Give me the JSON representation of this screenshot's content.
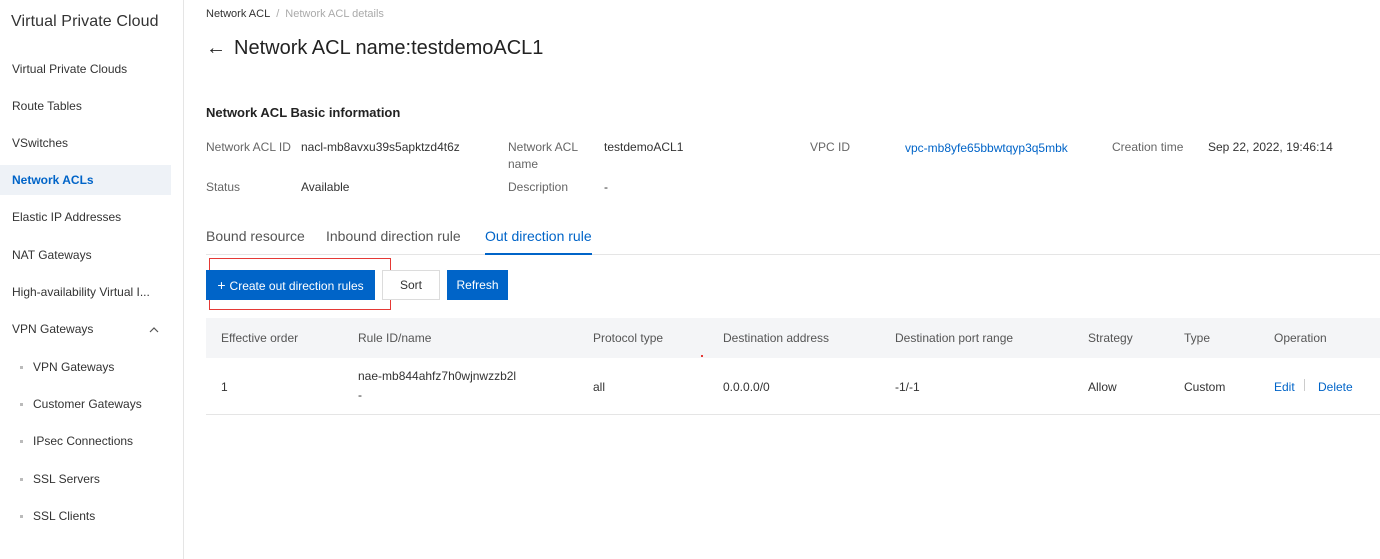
{
  "sidebar": {
    "title": "Virtual Private Cloud",
    "items": [
      {
        "label": "Virtual Private Clouds"
      },
      {
        "label": "Route Tables"
      },
      {
        "label": "VSwitches"
      },
      {
        "label": "Network ACLs",
        "active": true
      },
      {
        "label": "Elastic IP Addresses"
      },
      {
        "label": "NAT Gateways"
      },
      {
        "label": "High-availability Virtual I..."
      },
      {
        "label": "VPN Gateways",
        "expanded": true
      }
    ],
    "sub_items": [
      {
        "label": "VPN Gateways"
      },
      {
        "label": "Customer Gateways"
      },
      {
        "label": "IPsec Connections"
      },
      {
        "label": "SSL Servers"
      },
      {
        "label": "SSL Clients"
      }
    ]
  },
  "breadcrumb": {
    "first": "Network ACL",
    "separator": "/",
    "current": "Network ACL details"
  },
  "page": {
    "back_icon": "←",
    "title": "Network ACL name:testdemoACL1"
  },
  "basic_info": {
    "title": "Network ACL Basic information",
    "acl_id_label": "Network ACL ID",
    "acl_id_value": "nacl-mb8avxu39s5apktzd4t6z",
    "acl_name_label_1": "Network ACL",
    "acl_name_label_2": "name",
    "acl_name_value": "testdemoACL1",
    "vpc_id_label": "VPC ID",
    "vpc_id_value": "vpc-mb8yfe65bbwtqyp3q5mbk",
    "creation_label": "Creation time",
    "creation_value": "Sep 22, 2022, 19:46:14",
    "status_label": "Status",
    "status_value": "Available",
    "description_label": "Description",
    "description_value": "-"
  },
  "tabs": [
    {
      "label": "Bound resource"
    },
    {
      "label": "Inbound direction rule"
    },
    {
      "label": "Out direction rule",
      "active": true
    }
  ],
  "toolbar": {
    "create_label": "Create out direction rules",
    "sort_label": "Sort",
    "refresh_label": "Refresh"
  },
  "table": {
    "headers": {
      "order": "Effective order",
      "rule": "Rule ID/name",
      "protocol": "Protocol type",
      "destination": "Destination address",
      "port": "Destination port range",
      "strategy": "Strategy",
      "type": "Type",
      "operation": "Operation"
    },
    "rows": [
      {
        "order": "1",
        "rule_id": "nae-mb844ahfz7h0wjnwzzb2l",
        "rule_name": "-",
        "protocol": "all",
        "destination": "0.0.0.0/0",
        "port": "-1/-1",
        "strategy": "Allow",
        "type": "Custom",
        "edit_label": "Edit",
        "delete_label": "Delete"
      }
    ]
  },
  "colors": {
    "accent": "#0064c8",
    "highlight": "#e53935"
  }
}
